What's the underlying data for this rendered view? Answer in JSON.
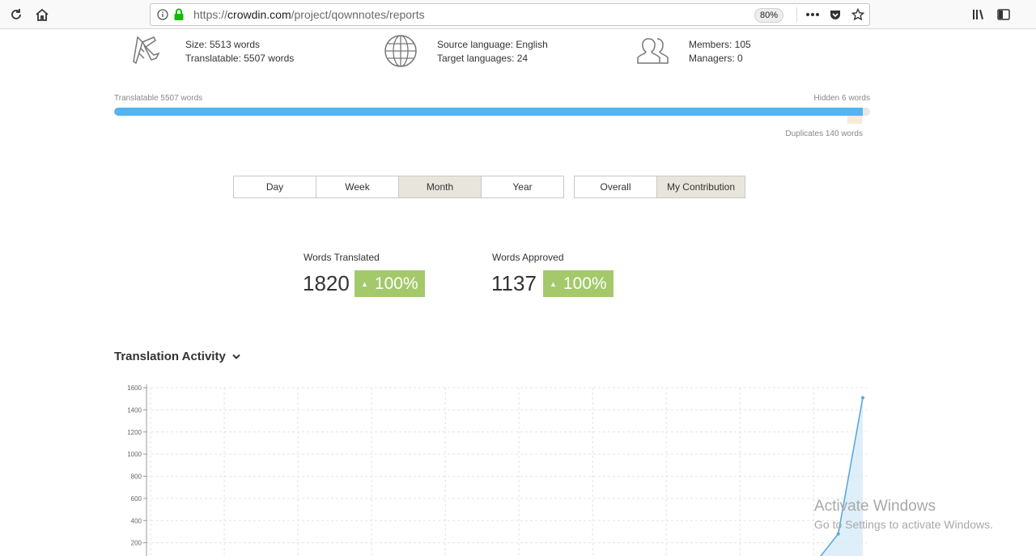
{
  "browser": {
    "url_prefix": "https://",
    "url_domain": "crowdin.com",
    "url_path": "/project/qownnotes/reports",
    "zoom": "80%"
  },
  "stats": {
    "size": "Size: 5513 words",
    "translatable": "Translatable: 5507 words",
    "source_language": "Source language: English",
    "target_languages": "Target languages: 24",
    "members": "Members: 105",
    "managers": "Managers: 0"
  },
  "progress": {
    "translatable_label": "Translatable 5507 words",
    "hidden_label": "Hidden 6 words",
    "duplicates_label": "Duplicates 140 words",
    "translatable_fraction": 0.99
  },
  "periods": [
    {
      "label": "Day",
      "active": false
    },
    {
      "label": "Week",
      "active": false
    },
    {
      "label": "Month",
      "active": true
    },
    {
      "label": "Year",
      "active": false
    }
  ],
  "scope": [
    {
      "label": "Overall",
      "active": false
    },
    {
      "label": "My Contribution",
      "active": true
    }
  ],
  "metrics": {
    "translated_label": "Words Translated",
    "translated_value": "1820",
    "translated_change": "100%",
    "approved_label": "Words Approved",
    "approved_value": "1137",
    "approved_change": "100%"
  },
  "section": {
    "title": "Translation Activity"
  },
  "colors": {
    "accent": "#52b5f0",
    "badge": "#a3c96b",
    "active_button": "#e8e6dc",
    "line": "#5aa9df",
    "area": "#d7ebf8"
  },
  "chart_data": {
    "type": "area",
    "title": "",
    "xlabel": "",
    "ylabel": "",
    "ylim": [
      0,
      1600
    ],
    "yticks": [
      "1600",
      "1400",
      "1200",
      "1000",
      "800",
      "600",
      "400",
      "200"
    ],
    "grid": true,
    "x": [
      0,
      1,
      2,
      3,
      4,
      5,
      6,
      7,
      8,
      9,
      10,
      11,
      12,
      13,
      14,
      15,
      16,
      17,
      18,
      19,
      20,
      21,
      22,
      23,
      24,
      25,
      26,
      27,
      28,
      29
    ],
    "series": [
      {
        "values": [
          0,
          0,
          0,
          0,
          0,
          0,
          0,
          0,
          0,
          0,
          0,
          0,
          0,
          0,
          0,
          0,
          0,
          0,
          0,
          0,
          0,
          0,
          0,
          0,
          0,
          0,
          0,
          0,
          280,
          1510
        ]
      }
    ]
  },
  "watermark": {
    "line1": "Activate Windows",
    "line2": "Go to Settings to activate Windows."
  }
}
